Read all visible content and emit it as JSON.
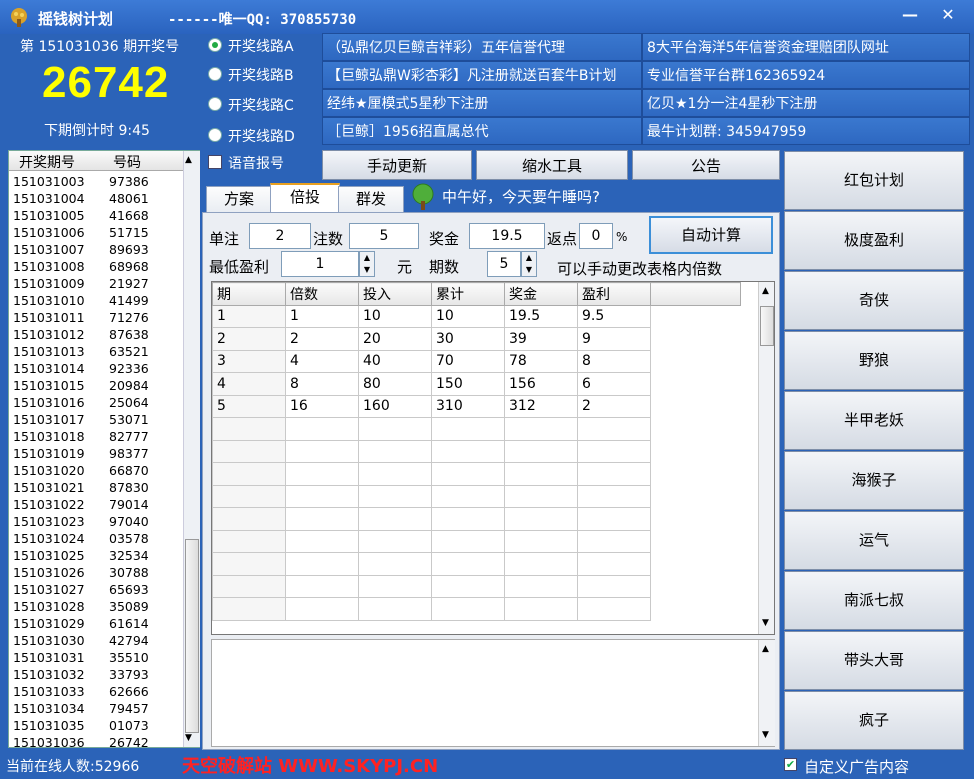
{
  "window": {
    "title": "摇钱树计划",
    "qq": "------唯一QQ: 370855730",
    "minimize": "—",
    "close": "✕"
  },
  "lottery": {
    "issue_label": "第 151031036 期开奖号",
    "number": "26742",
    "countdown": "下期倒计时 9:45"
  },
  "lines": [
    {
      "label": "开奖线路A",
      "selected": true
    },
    {
      "label": "开奖线路B",
      "selected": false
    },
    {
      "label": "开奖线路C",
      "selected": false
    },
    {
      "label": "开奖线路D",
      "selected": false
    }
  ],
  "voice_label": "语音报号",
  "ads": [
    "（弘鼎亿贝巨鲸吉祥彩）五年信誉代理",
    "8大平台海洋5年信誉资金理赔团队网址",
    "【巨鲸弘鼎W彩杏彩】凡注册就送百套牛B计划",
    "专业信誉平台群162365924",
    "经纬★厘模式5星秒下注册",
    "亿贝★1分一注4星秒下注册",
    "［巨鲸］1956招直属总代",
    "最牛计划群: 345947959"
  ],
  "history": {
    "headers": [
      "开奖期号",
      "号码"
    ],
    "rows": [
      [
        "151031003",
        "97386"
      ],
      [
        "151031004",
        "48061"
      ],
      [
        "151031005",
        "41668"
      ],
      [
        "151031006",
        "51715"
      ],
      [
        "151031007",
        "89693"
      ],
      [
        "151031008",
        "68968"
      ],
      [
        "151031009",
        "21927"
      ],
      [
        "151031010",
        "41499"
      ],
      [
        "151031011",
        "71276"
      ],
      [
        "151031012",
        "87638"
      ],
      [
        "151031013",
        "63521"
      ],
      [
        "151031014",
        "92336"
      ],
      [
        "151031015",
        "20984"
      ],
      [
        "151031016",
        "25064"
      ],
      [
        "151031017",
        "53071"
      ],
      [
        "151031018",
        "82777"
      ],
      [
        "151031019",
        "98377"
      ],
      [
        "151031020",
        "66870"
      ],
      [
        "151031021",
        "87830"
      ],
      [
        "151031022",
        "79014"
      ],
      [
        "151031023",
        "97040"
      ],
      [
        "151031024",
        "03578"
      ],
      [
        "151031025",
        "32534"
      ],
      [
        "151031026",
        "30788"
      ],
      [
        "151031027",
        "65693"
      ],
      [
        "151031028",
        "35089"
      ],
      [
        "151031029",
        "61614"
      ],
      [
        "151031030",
        "42794"
      ],
      [
        "151031031",
        "35510"
      ],
      [
        "151031032",
        "33793"
      ],
      [
        "151031033",
        "62666"
      ],
      [
        "151031034",
        "79457"
      ],
      [
        "151031035",
        "01073"
      ],
      [
        "151031036",
        "26742"
      ]
    ]
  },
  "toolbar": {
    "manual_update": "手动更新",
    "shrink_tool": "缩水工具",
    "notice": "公告"
  },
  "tabs": [
    "方案",
    "倍投",
    "群发"
  ],
  "greeting": "中午好，今天要午睡吗?",
  "calc": {
    "unit_label": "单注",
    "unit_value": "2",
    "count_label": "注数",
    "count_value": "5",
    "prize_label": "奖金",
    "prize_value": "19.5",
    "rebate_label": "返点",
    "rebate_value": "0",
    "percent": "%",
    "auto_button": "自动计算",
    "min_profit_label": "最低盈利",
    "min_profit_value": "1",
    "yuan": "元",
    "periods_label": "期数",
    "periods_value": "5",
    "hint": "可以手动更改表格内倍数"
  },
  "grid": {
    "headers": [
      "期",
      "倍数",
      "投入",
      "累计",
      "奖金",
      "盈利"
    ],
    "rows": [
      [
        "1",
        "1",
        "10",
        "10",
        "19.5",
        "9.5"
      ],
      [
        "2",
        "2",
        "20",
        "30",
        "39",
        "9"
      ],
      [
        "3",
        "4",
        "40",
        "70",
        "78",
        "8"
      ],
      [
        "4",
        "8",
        "80",
        "150",
        "156",
        "6"
      ],
      [
        "5",
        "16",
        "160",
        "310",
        "312",
        "2"
      ]
    ]
  },
  "plans": [
    "红包计划",
    "极度盈利",
    "奇侠",
    "野狼",
    "半甲老妖",
    "海猴子",
    "运气",
    "南派七叔",
    "带头大哥",
    "疯子"
  ],
  "status": {
    "online": "当前在线人数:52966",
    "watermark": "天空破解站 WWW.SKYPJ.CN",
    "custom_ad": "自定义广告内容"
  }
}
